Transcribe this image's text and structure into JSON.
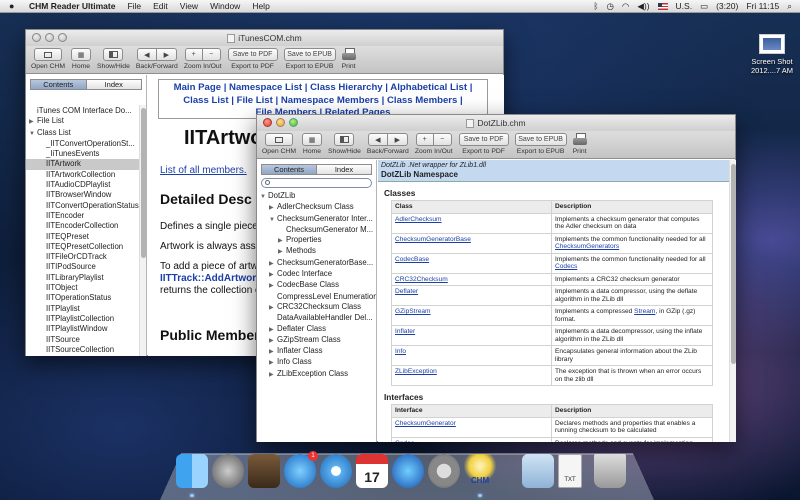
{
  "menubar": {
    "app": "CHM Reader Ultimate",
    "items": [
      "File",
      "Edit",
      "View",
      "Window",
      "Help"
    ],
    "battery": "(3:20)",
    "input": "U.S.",
    "clock": "Fri 11:15"
  },
  "desktop_icon": {
    "label1": "Screen Shot",
    "label2": "2012....7 AM"
  },
  "toolbar": {
    "open": "Open CHM",
    "home": "Home",
    "showhide": "Show/Hide",
    "backforward": "Back/Forward",
    "zoom": "Zoom In/Out",
    "export_pdf": "Export to PDF",
    "export_epub": "Export to EPUB",
    "print": "Print",
    "save_pdf": "Save to PDF",
    "save_epub": "Save to EPUB",
    "zoom_in": "+",
    "zoom_out": "−"
  },
  "win1": {
    "title": "iTunesCOM.chm",
    "tabs": [
      "Contents",
      "Index"
    ],
    "tree": [
      {
        "label": "iTunes COM Interface Do...",
        "arrow": "",
        "indent": 0
      },
      {
        "label": "File List",
        "arrow": "▶",
        "indent": 0
      },
      {
        "label": "Class List",
        "arrow": "▼",
        "indent": 0
      },
      {
        "label": "_IITConvertOperationSt...",
        "arrow": "",
        "indent": 1
      },
      {
        "label": "_IiTunesEvents",
        "arrow": "",
        "indent": 1
      },
      {
        "label": "IITArtwork",
        "arrow": "",
        "indent": 1,
        "selected": true
      },
      {
        "label": "IITArtworkCollection",
        "arrow": "",
        "indent": 1
      },
      {
        "label": "IITAudioCDPlaylist",
        "arrow": "",
        "indent": 1
      },
      {
        "label": "IITBrowserWindow",
        "arrow": "",
        "indent": 1
      },
      {
        "label": "IITConvertOperationStatus",
        "arrow": "",
        "indent": 1
      },
      {
        "label": "IITEncoder",
        "arrow": "",
        "indent": 1
      },
      {
        "label": "IITEncoderCollection",
        "arrow": "",
        "indent": 1
      },
      {
        "label": "IITEQPreset",
        "arrow": "",
        "indent": 1
      },
      {
        "label": "IITEQPresetCollection",
        "arrow": "",
        "indent": 1
      },
      {
        "label": "IITFileOrCDTrack",
        "arrow": "",
        "indent": 1
      },
      {
        "label": "IITIPodSource",
        "arrow": "",
        "indent": 1
      },
      {
        "label": "IITLibraryPlaylist",
        "arrow": "",
        "indent": 1
      },
      {
        "label": "IITObject",
        "arrow": "",
        "indent": 1
      },
      {
        "label": "IITOperationStatus",
        "arrow": "",
        "indent": 1
      },
      {
        "label": "IITPlaylist",
        "arrow": "",
        "indent": 1
      },
      {
        "label": "IITPlaylistCollection",
        "arrow": "",
        "indent": 1
      },
      {
        "label": "IITPlaylistWindow",
        "arrow": "",
        "indent": 1
      },
      {
        "label": "IITSource",
        "arrow": "",
        "indent": 1
      },
      {
        "label": "IITSourceCollection",
        "arrow": "",
        "indent": 1
      }
    ],
    "nav_line1": "Main Page | Namespace List | Class Hierarchy | Alphabetical List |",
    "nav_line2": "Class List | File List | Namespace Members | Class Members |",
    "nav_line3": "File Members | Related Pages",
    "heading": "IITArtwo",
    "members_link": "List of all members.",
    "detailed": "Detailed Desc",
    "p1": "Defines a single piece c",
    "p2": "Artwork is always asso",
    "p3": "To add a piece of artw",
    "p3_link": "IITTrack::AddArtwork",
    "p4": "returns the collection c",
    "public": "Public Member"
  },
  "win2": {
    "title": "DotZLib.chm",
    "tabs": [
      "Contents",
      "Index"
    ],
    "tree": [
      {
        "label": "DotZLib",
        "arrow": "▼",
        "indent": 0
      },
      {
        "label": "AdlerChecksum Class",
        "arrow": "▶",
        "indent": 1
      },
      {
        "label": "ChecksumGenerator Inter...",
        "arrow": "▼",
        "indent": 1
      },
      {
        "label": "ChecksumGenerator M...",
        "arrow": "",
        "indent": 2
      },
      {
        "label": "Properties",
        "arrow": "▶",
        "indent": 2
      },
      {
        "label": "Methods",
        "arrow": "▶",
        "indent": 2
      },
      {
        "label": "ChecksumGeneratorBase...",
        "arrow": "▶",
        "indent": 1
      },
      {
        "label": "Codec Interface",
        "arrow": "▶",
        "indent": 1
      },
      {
        "label": "CodecBase Class",
        "arrow": "▶",
        "indent": 1
      },
      {
        "label": "CompressLevel Enumeration",
        "arrow": "",
        "indent": 1
      },
      {
        "label": "CRC32Checksum Class",
        "arrow": "▶",
        "indent": 1
      },
      {
        "label": "DataAvailableHandler Del...",
        "arrow": "",
        "indent": 1
      },
      {
        "label": "Deflater Class",
        "arrow": "▶",
        "indent": 1
      },
      {
        "label": "GZipStream Class",
        "arrow": "▶",
        "indent": 1
      },
      {
        "label": "Inflater Class",
        "arrow": "▶",
        "indent": 1
      },
      {
        "label": "Info Class",
        "arrow": "▶",
        "indent": 1
      },
      {
        "label": "ZLibException Class",
        "arrow": "▶",
        "indent": 1
      }
    ],
    "banner_italic": "DotZLib .Net wrapper for ZLib1.dll",
    "banner_bold": "DotZLib Namespace",
    "classes_heading": "Classes",
    "col_class": "Class",
    "col_desc": "Description",
    "classes": [
      {
        "name": "AdlerChecksum",
        "desc": "Implements a checksum generator that computes the Adler checksum on data"
      },
      {
        "name": "ChecksumGeneratorBase",
        "desc": "Implements the common functionality needed for all ",
        "desc_link": "ChecksumGenerators"
      },
      {
        "name": "CodecBase",
        "desc": "Implements the common functionality needed for all ",
        "desc_link": "Codecs"
      },
      {
        "name": "CRC32Checksum",
        "desc": "Implements a CRC32 checksum generator"
      },
      {
        "name": "Deflater",
        "desc": "Implements a data compressor, using the deflate algorithm in the ZLib dll"
      },
      {
        "name": "GZipStream",
        "desc": "Implements a compressed ",
        "desc_link": "Stream",
        "desc_after": ", in GZip (.gz) format."
      },
      {
        "name": "Inflater",
        "desc": "Implements a data decompressor, using the inflate algorithm in the ZLib dll"
      },
      {
        "name": "Info",
        "desc": "Encapsulates general information about the ZLib library"
      },
      {
        "name": "ZLibException",
        "desc": "The exception that is thrown when an error occurs on the zlib dll"
      }
    ],
    "interfaces_heading": "Interfaces",
    "col_interface": "Interface",
    "interfaces": [
      {
        "name": "ChecksumGenerator",
        "desc": "Declares methods and properties that enables a running checksum to be calculated"
      },
      {
        "name": "Codec",
        "desc": "Declares methods and events for implementing"
      }
    ]
  },
  "dock": {
    "chm_label": "CHM",
    "txt_label": "TXT"
  }
}
